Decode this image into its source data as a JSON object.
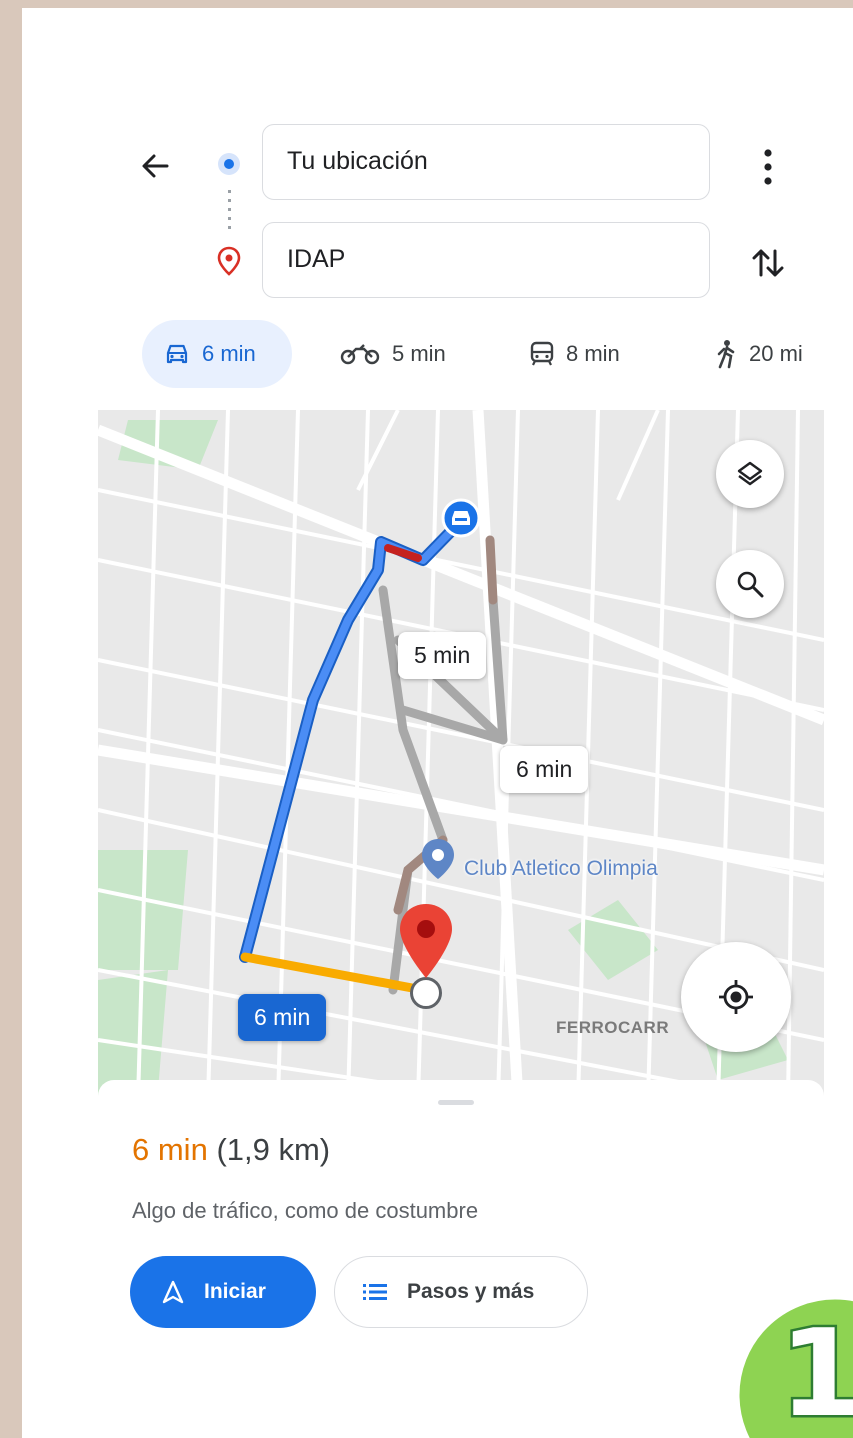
{
  "directions": {
    "origin": {
      "value": "Tu ubicación"
    },
    "destination": {
      "value": "IDAP"
    }
  },
  "travel_modes": [
    {
      "mode": "car",
      "icon": "car-icon",
      "time": "6 min",
      "selected": true
    },
    {
      "mode": "motorcycle",
      "icon": "motorcycle-icon",
      "time": "5 min",
      "selected": false
    },
    {
      "mode": "transit",
      "icon": "transit-icon",
      "time": "8 min",
      "selected": false
    },
    {
      "mode": "walk",
      "icon": "walk-icon",
      "time": "20 mi",
      "selected": false
    }
  ],
  "map": {
    "route_labels": {
      "alt1": "5 min",
      "alt2": "6 min",
      "selected": "6 min"
    },
    "poi": "Club Atletico Olimpia",
    "street": "FERROCARR"
  },
  "summary": {
    "time": "6 min",
    "distance": "(1,9 km)",
    "traffic": "Algo de tráfico, como de costumbre",
    "start_label": "Iniciar",
    "steps_label": "Pasos y más"
  },
  "badge": {
    "number": "1"
  },
  "colors": {
    "accent": "#1a73e8",
    "route_primary": "#4285f4",
    "route_alt": "#a8a8a8",
    "eta_orange": "#e37400",
    "badge_green": "#8ed352"
  }
}
